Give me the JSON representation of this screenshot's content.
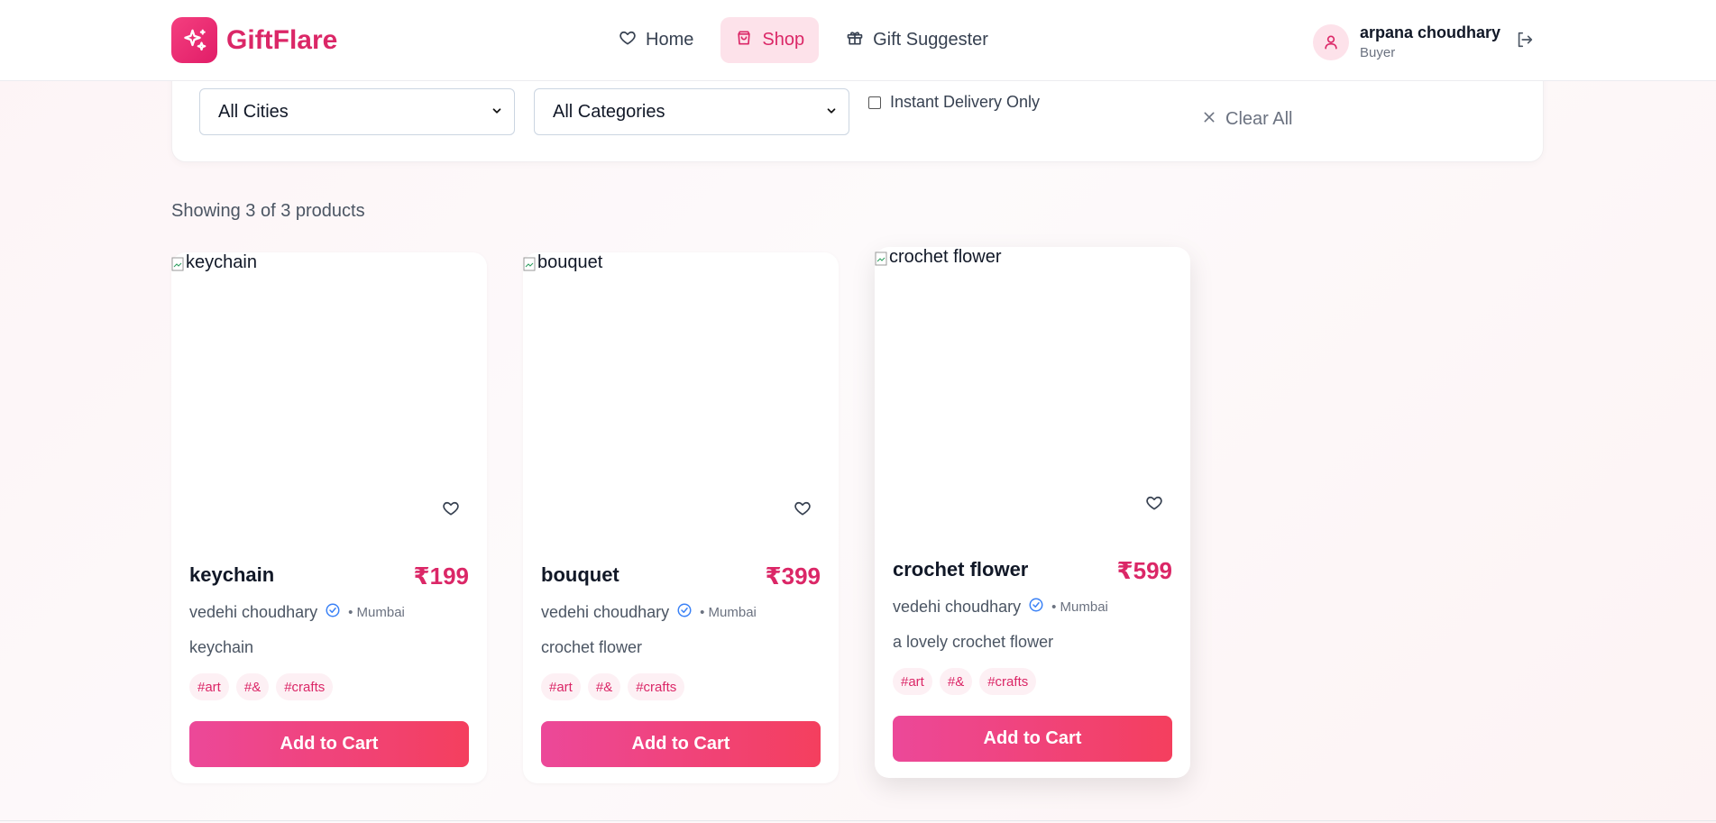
{
  "header": {
    "brand": "GiftFlare",
    "nav": [
      {
        "label": "Home",
        "icon": "heart-icon"
      },
      {
        "label": "Shop",
        "icon": "shopping-bag-icon",
        "active": true
      },
      {
        "label": "Gift Suggester",
        "icon": "gift-icon"
      }
    ],
    "user": {
      "name": "arpana choudhary",
      "role": "Buyer"
    }
  },
  "filters": {
    "city": {
      "value": "All Cities"
    },
    "category": {
      "value": "All Categories"
    },
    "instant_label": "Instant Delivery Only",
    "instant_checked": false,
    "clear_label": "Clear All"
  },
  "results": {
    "summary": "Showing 3 of 3 products"
  },
  "products": [
    {
      "alt": "keychain",
      "name": "keychain",
      "price": "₹199",
      "seller": "vedehi choudhary",
      "city": "• Mumbai",
      "description": "keychain",
      "tags": [
        "#art",
        "#&",
        "#crafts"
      ],
      "cta": "Add to Cart"
    },
    {
      "alt": "bouquet",
      "name": "bouquet",
      "price": "₹399",
      "seller": "vedehi choudhary",
      "city": "• Mumbai",
      "description": "crochet flower",
      "tags": [
        "#art",
        "#&",
        "#crafts"
      ],
      "cta": "Add to Cart"
    },
    {
      "alt": "crochet flower",
      "name": "crochet flower",
      "price": "₹599",
      "seller": "vedehi choudhary",
      "city": "• Mumbai",
      "description": "a lovely crochet flower",
      "tags": [
        "#art",
        "#&",
        "#crafts"
      ],
      "cta": "Add to Cart"
    }
  ],
  "colors": {
    "brand": "#db2767",
    "button_start": "#ec4899",
    "button_end": "#f43f5e",
    "verified": "#3b82f6"
  }
}
